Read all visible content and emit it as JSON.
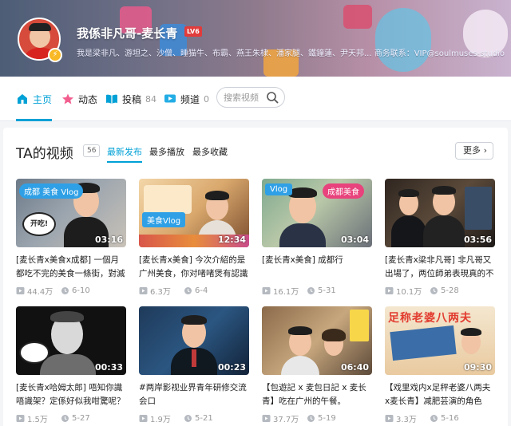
{
  "profile": {
    "name": "我係非凡哥-麦长青",
    "level": "LV6",
    "sign": "我是梁非凡、游坦之、沙僧、睡猫牛、布霸、燕王朱棣、潘家腿、鐵鐘蓮、尹天邦... 商务联系：VIP@soulmuses-studio"
  },
  "nav": {
    "home": "主页",
    "dynamic": "动态",
    "upload": "投稿",
    "upload_count": "84",
    "channel": "频道",
    "channel_count": "0",
    "search_placeholder": "搜索视频"
  },
  "videos_section": {
    "title": "TA的视频",
    "count": "56",
    "sort_latest": "最新发布",
    "sort_most_played": "最多播放",
    "sort_most_favorited": "最多收藏",
    "more": "更多"
  },
  "colors": {
    "accent": "#00a1d6",
    "level_badge": "#e23b3b"
  },
  "videos": [
    {
      "duration": "03:16",
      "title": "[麦长青x美食x成都] 一個月都吃不完的美食一條街，對滅",
      "views": "44.4万",
      "date": "6-10",
      "thumb_tag": "成都 美食 Vlog",
      "thumb_text": "开吃!"
    },
    {
      "duration": "12:34",
      "title": "[麦长青x美食] 今次介紹的是广州美食，你对啫啫煲有認識",
      "views": "6.3万",
      "date": "6-4",
      "thumb_tag": "美食Vlog",
      "thumb_text": ""
    },
    {
      "duration": "03:04",
      "title": "[麦长青x美食] 成都行",
      "views": "16.1万",
      "date": "5-31",
      "thumb_tag": "Vlog",
      "thumb_text": "成都美食"
    },
    {
      "duration": "03:56",
      "title": "[麦长青x梁非凡哥] 非凡哥又出場了，两位師弟表現真的不",
      "views": "10.1万",
      "date": "5-28",
      "thumb_tag": "",
      "thumb_text": ""
    },
    {
      "duration": "00:33",
      "title": "[麦长青x哈姆太郎] 唔知你識唔識架？定係好似我咁驚呢？",
      "views": "1.5万",
      "date": "5-27",
      "thumb_tag": "",
      "thumb_text": ""
    },
    {
      "duration": "00:23",
      "title": "#两岸影视业界青年研修交流会口",
      "views": "1.9万",
      "date": "5-21",
      "thumb_tag": "",
      "thumb_text": ""
    },
    {
      "duration": "06:40",
      "title": "【包遊記 x 麦包日記 x 麦长青】吃在广州的午餐。",
      "views": "37.7万",
      "date": "5-19",
      "thumb_tag": "",
      "thumb_text": ""
    },
    {
      "duration": "09:30",
      "title": "【戏里戏内x足秤老婆八两夫x麦长青】减肥芸演的角色",
      "views": "3.3万",
      "date": "5-16",
      "thumb_tag": "",
      "thumb_text": "足称老婆八两夫"
    }
  ]
}
